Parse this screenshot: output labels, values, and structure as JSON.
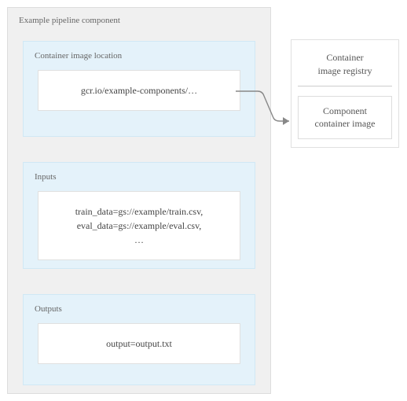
{
  "main": {
    "title": "Example pipeline component",
    "location": {
      "label": "Container image location",
      "value": "gcr.io/example-components/…"
    },
    "inputs": {
      "label": "Inputs",
      "line1": "train_data=gs://example/train.csv,",
      "line2": "eval_data=gs://example/eval.csv,",
      "line3": "…"
    },
    "outputs": {
      "label": "Outputs",
      "value": "output=output.txt"
    }
  },
  "registry": {
    "title_line1": "Container",
    "title_line2": "image registry",
    "box_line1": "Component",
    "box_line2": "container image"
  }
}
